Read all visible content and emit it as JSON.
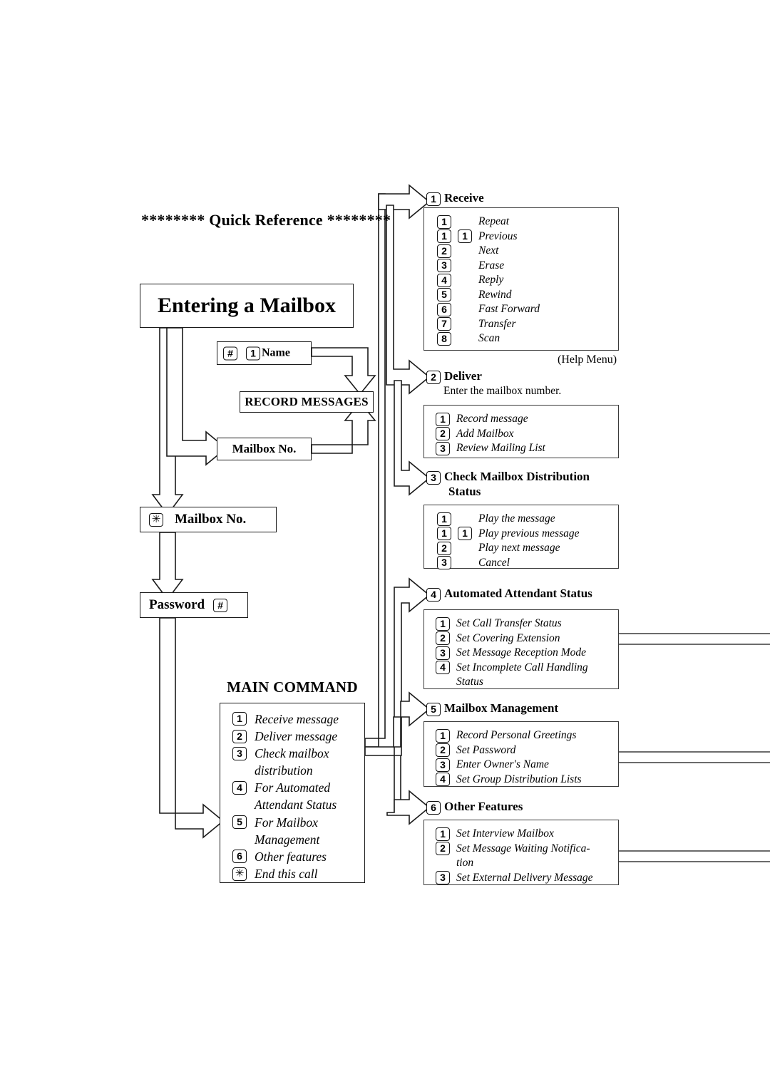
{
  "page": {
    "quick_reference_title": "******** Quick Reference ********",
    "main_title": "Entering a Mailbox",
    "help_menu_label": "(Help Menu)",
    "main_command_title": "MAIN COMMAND"
  },
  "flow": {
    "name_box": {
      "key1": "#",
      "key2": "1",
      "label": "Name"
    },
    "record_messages": "RECORD MESSAGES",
    "mailbox_no_1": "Mailbox No.",
    "mailbox_no_2": {
      "key": "✳",
      "label": "Mailbox No."
    },
    "password": {
      "label": "Password",
      "key": "#"
    }
  },
  "main_command": {
    "items": [
      {
        "key": "1",
        "text": "Receive message"
      },
      {
        "key": "2",
        "text": "Deliver message"
      },
      {
        "key": "3",
        "text": "Check mailbox",
        "cont": "distribution"
      },
      {
        "key": "4",
        "text": "For Automated",
        "cont": "Attendant Status"
      },
      {
        "key": "5",
        "text": "For Mailbox",
        "cont": "Management"
      },
      {
        "key": "6",
        "text": "Other features"
      },
      {
        "key": "✳",
        "text": "End this call"
      }
    ]
  },
  "sections": [
    {
      "key": "1",
      "title": "Receive",
      "title_line2": "",
      "note": "",
      "items": [
        {
          "key": "1",
          "key2": "",
          "text": "Repeat"
        },
        {
          "key": "1",
          "key2": "1",
          "text": "Previous"
        },
        {
          "key": "2",
          "key2": "",
          "text": "Next"
        },
        {
          "key": "3",
          "key2": "",
          "text": "Erase"
        },
        {
          "key": "4",
          "key2": "",
          "text": "Reply"
        },
        {
          "key": "5",
          "key2": "",
          "text": "Rewind"
        },
        {
          "key": "6",
          "key2": "",
          "text": "Fast Forward"
        },
        {
          "key": "7",
          "key2": "",
          "text": "Transfer"
        },
        {
          "key": "8",
          "key2": "",
          "text": "Scan"
        }
      ]
    },
    {
      "key": "2",
      "title": "Deliver",
      "title_line2": "",
      "note": "Enter the mailbox number.",
      "items": [
        {
          "key": "1",
          "key2": "",
          "text": "Record message"
        },
        {
          "key": "2",
          "key2": "",
          "text": "Add Mailbox"
        },
        {
          "key": "3",
          "key2": "",
          "text": "Review Mailing List"
        }
      ]
    },
    {
      "key": "3",
      "title": "Check Mailbox Distribution",
      "title_line2": "Status",
      "note": "",
      "items": [
        {
          "key": "1",
          "key2": "",
          "text": "Play the message"
        },
        {
          "key": "1",
          "key2": "1",
          "text": "Play previous message"
        },
        {
          "key": "2",
          "key2": "",
          "text": "Play next message"
        },
        {
          "key": "3",
          "key2": "",
          "text": "Cancel"
        }
      ]
    },
    {
      "key": "4",
      "title": "Automated Attendant Status",
      "title_line2": "",
      "note": "",
      "items": [
        {
          "key": "1",
          "key2": "",
          "text": "Set Call Transfer Status"
        },
        {
          "key": "2",
          "key2": "",
          "text": "Set Covering Extension"
        },
        {
          "key": "3",
          "key2": "",
          "text": "Set Message Reception Mode"
        },
        {
          "key": "4",
          "key2": "",
          "text": "Set Incomplete Call Handling",
          "cont": "Status"
        }
      ]
    },
    {
      "key": "5",
      "title": "Mailbox Management",
      "title_line2": "",
      "note": "",
      "items": [
        {
          "key": "1",
          "key2": "",
          "text": "Record Personal Greetings"
        },
        {
          "key": "2",
          "key2": "",
          "text": "Set Password"
        },
        {
          "key": "3",
          "key2": "",
          "text": "Enter Owner's Name"
        },
        {
          "key": "4",
          "key2": "",
          "text": "Set Group Distribution Lists"
        }
      ]
    },
    {
      "key": "6",
      "title": "Other Features",
      "title_line2": "",
      "note": "",
      "items": [
        {
          "key": "1",
          "key2": "",
          "text": "Set Interview Mailbox"
        },
        {
          "key": "2",
          "key2": "",
          "text": "Set Message Waiting Notifica-",
          "cont": "tion"
        },
        {
          "key": "3",
          "key2": "",
          "text": "Set External Delivery Message"
        }
      ]
    }
  ],
  "colors": {
    "ink": "#000000",
    "line": "#1a1a1a",
    "paper": "#ffffff"
  }
}
